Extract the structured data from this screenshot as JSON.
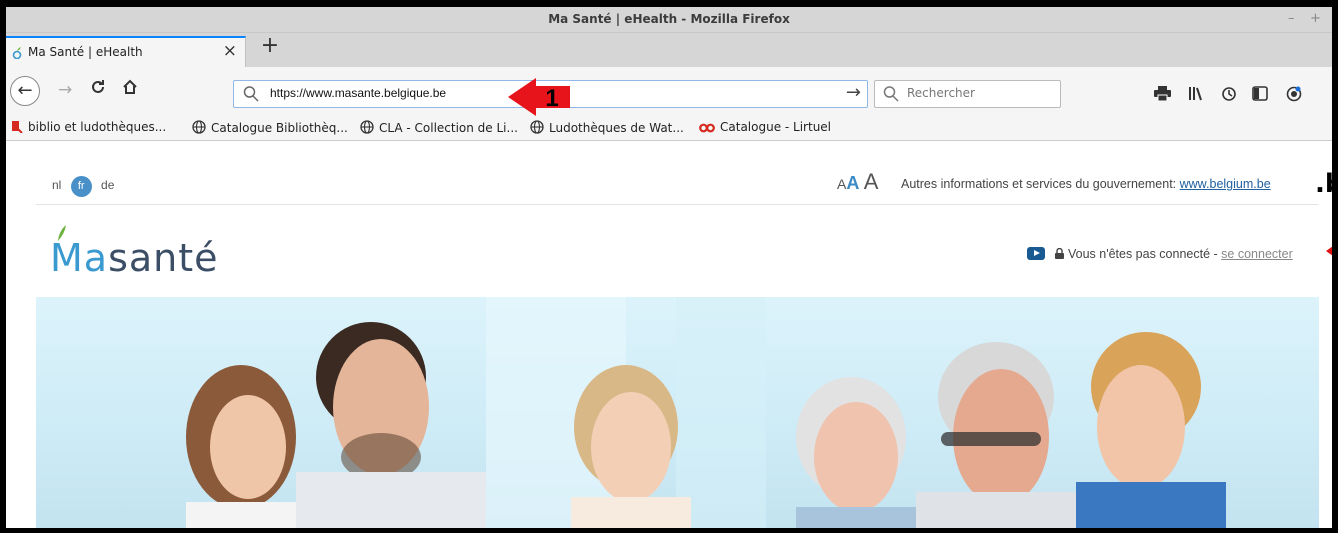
{
  "window": {
    "title": "Ma Santé | eHealth - Mozilla Firefox",
    "minimize": "–",
    "maximize": "+"
  },
  "tab": {
    "label": "Ma Santé | eHealth",
    "close": "×",
    "new_tab": "+"
  },
  "nav": {
    "url": "https://www.masante.belgique.be",
    "search_placeholder": "Rechercher",
    "go_arrow": "→"
  },
  "bookmarks": [
    {
      "label": "biblio et ludothèques...",
      "icon": "bookmark-red-icon"
    },
    {
      "label": "Catalogue Bibliothèq...",
      "icon": "globe-icon"
    },
    {
      "label": "CLA - Collection de Li...",
      "icon": "globe-icon"
    },
    {
      "label": "Ludothèques de Wat...",
      "icon": "globe-icon"
    },
    {
      "label": "Catalogue - Lirtuel",
      "icon": "infinity-icon"
    }
  ],
  "page": {
    "langs": {
      "nl": "nl",
      "fr": "fr",
      "de": "de"
    },
    "font_sizes": [
      "A",
      "A",
      "A"
    ],
    "gov_text": "Autres informations et services du gouvernement:",
    "gov_link": "www.belgium.be",
    "edge_b": ".b",
    "logo": {
      "ma": "Ma",
      "sante": "santé"
    },
    "connection": {
      "status": "Vous n'êtes pas connecté -",
      "login": "se connecter"
    }
  },
  "annotation": {
    "number": "1",
    "color": "#e8141b"
  },
  "colors": {
    "accent": "#0a84ff",
    "logo_blue": "#3a9ad0",
    "logo_dark": "#3b4e66"
  }
}
